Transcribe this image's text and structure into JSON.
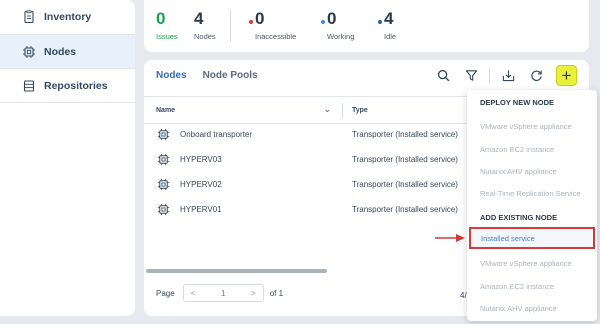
{
  "sidebar": {
    "items": [
      {
        "label": "Inventory",
        "icon": "inventory-icon",
        "active": false
      },
      {
        "label": "Nodes",
        "icon": "chip-icon",
        "active": true
      },
      {
        "label": "Repositories",
        "icon": "database-icon",
        "active": false
      }
    ]
  },
  "stats": {
    "issues": {
      "value": "0",
      "label": "Issues",
      "color": "#1aa34a"
    },
    "nodes": {
      "value": "4",
      "label": "Nodes"
    },
    "inaccessible": {
      "value": "0",
      "label": "Inaccessible",
      "dot_color": "#d43b3b"
    },
    "working": {
      "value": "0",
      "label": "Working",
      "dot_color": "#3b8de0"
    },
    "idle": {
      "value": "4",
      "label": "Idle",
      "dot_color": "#2f5f9f"
    }
  },
  "tabs": [
    {
      "label": "Nodes",
      "active": true
    },
    {
      "label": "Node Pools",
      "active": false
    }
  ],
  "toolbar": {
    "icons": [
      "search-icon",
      "filter-icon",
      "download-icon",
      "refresh-icon"
    ],
    "add_label": "+"
  },
  "table": {
    "columns": [
      "Name",
      "Type"
    ],
    "rows": [
      {
        "name": "Onboard transporter",
        "type": "Transporter (Installed service)"
      },
      {
        "name": "HYPERV03",
        "type": "Transporter (Installed service)"
      },
      {
        "name": "HYPERV02",
        "type": "Transporter (Installed service)"
      },
      {
        "name": "HYPERV01",
        "type": "Transporter (Installed service)"
      }
    ]
  },
  "pager": {
    "label": "Page",
    "prev": "<",
    "current": "1",
    "next": ">",
    "of_label": "of 1",
    "right_text": "4/"
  },
  "dropdown": {
    "deploy_header": "DEPLOY NEW NODE",
    "deploy_items": [
      "VMware vSphere appliance",
      "Amazon EC2 instance",
      "Nutanix AHV appliance",
      "Real-Time Replication Service"
    ],
    "add_header": "ADD EXISTING NODE",
    "highlighted_item": "Installed service",
    "add_items": [
      "VMware vSphere appliance",
      "Amazon EC2 instance",
      "Nutanix AHV appliance"
    ],
    "highlight_color": "#d43b3b"
  }
}
